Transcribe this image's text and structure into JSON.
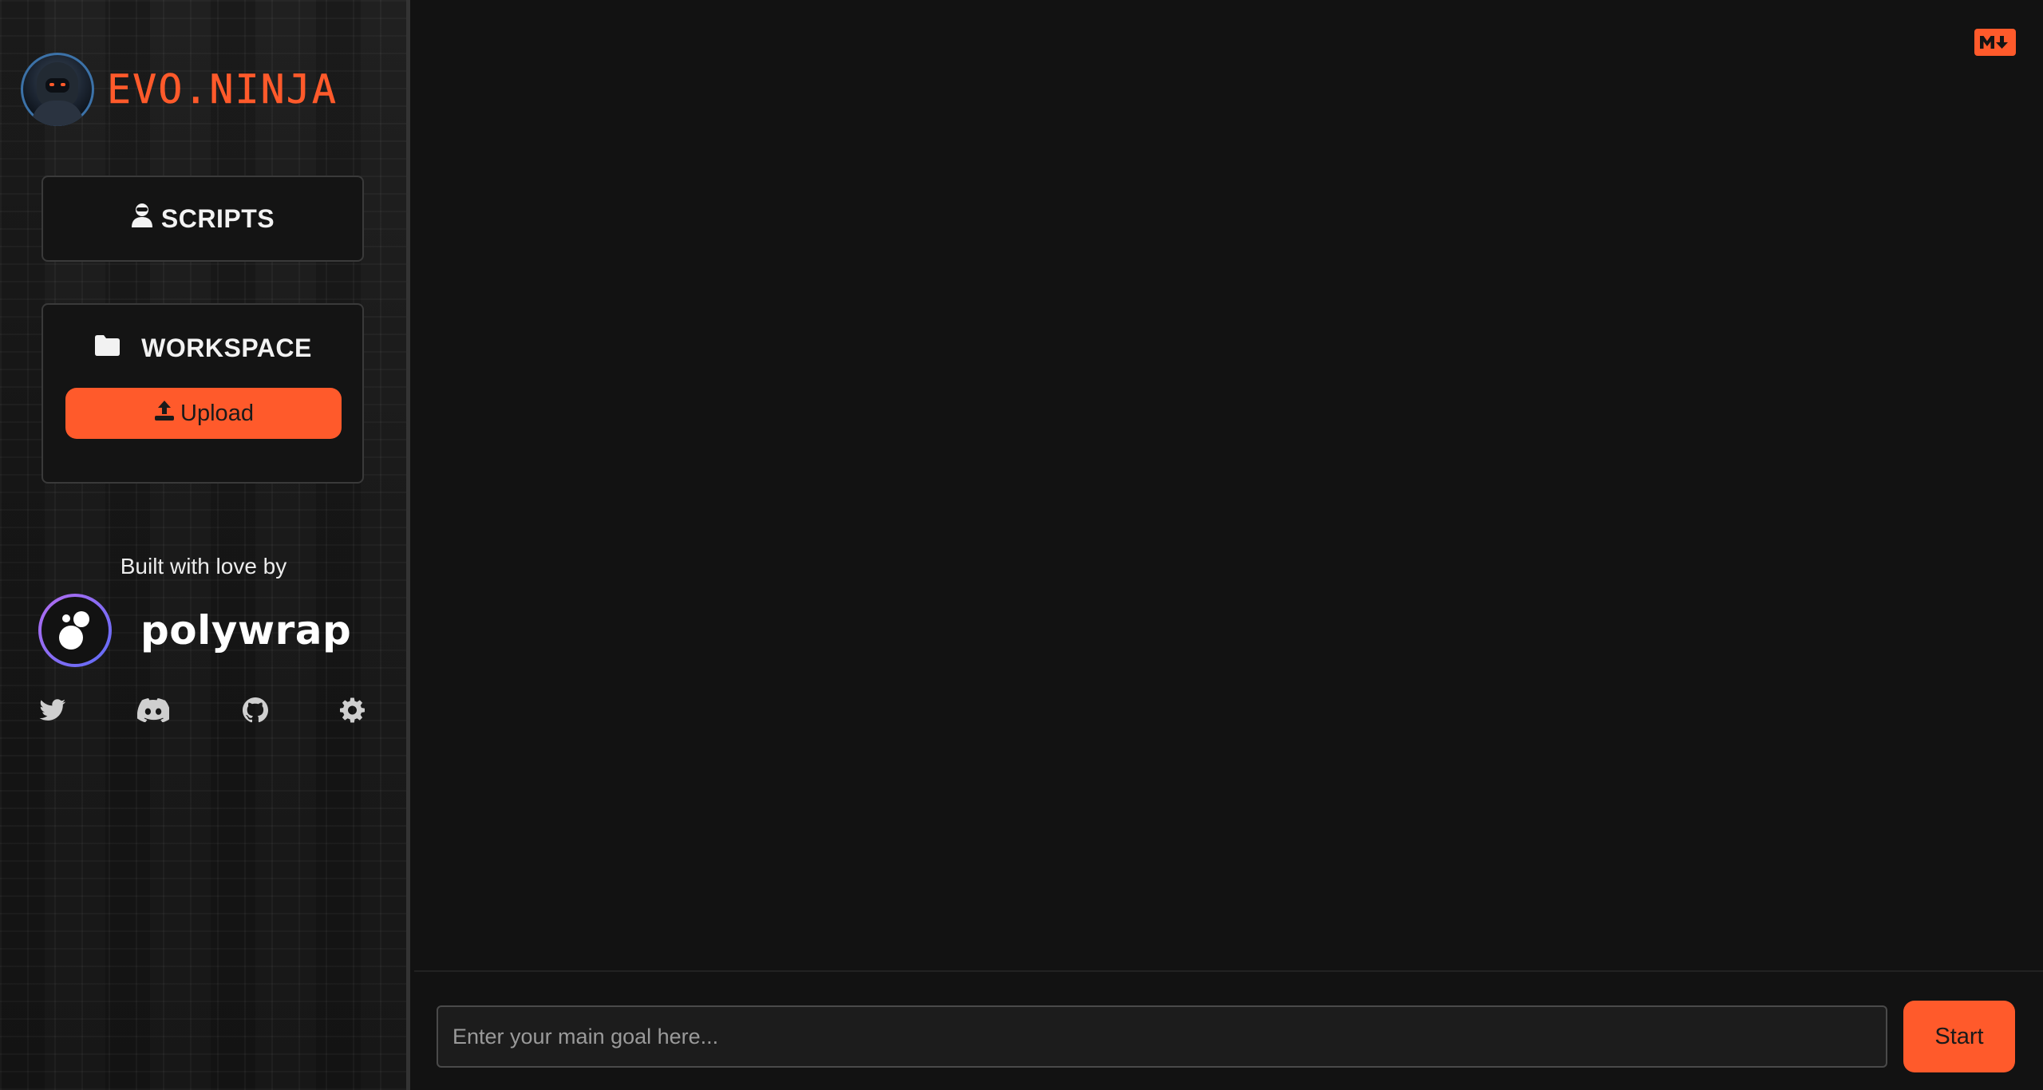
{
  "sidebar": {
    "brand": {
      "name": "EVO.NINJA",
      "avatar_icon": "ninja-avatar-icon"
    },
    "scripts": {
      "label": "SCRIPTS",
      "icon": "user-ninja-icon"
    },
    "workspace": {
      "label": "WORKSPACE",
      "icon": "folder-icon",
      "upload_label": "Upload",
      "upload_icon": "upload-icon"
    },
    "credits": {
      "built_by": "Built with love by",
      "org_name": "polywrap"
    },
    "socials": [
      {
        "name": "twitter",
        "icon": "twitter-icon"
      },
      {
        "name": "discord",
        "icon": "discord-icon"
      },
      {
        "name": "github",
        "icon": "github-icon"
      },
      {
        "name": "settings",
        "icon": "gear-icon"
      }
    ]
  },
  "main": {
    "markdown_icon": "markdown-icon",
    "goal_input": {
      "value": "",
      "placeholder": "Enter your main goal here..."
    },
    "start_label": "Start"
  },
  "colors": {
    "accent": "#ff5a2b",
    "background": "#121212",
    "card_background": "#141414",
    "card_border": "#3a3a3a"
  }
}
